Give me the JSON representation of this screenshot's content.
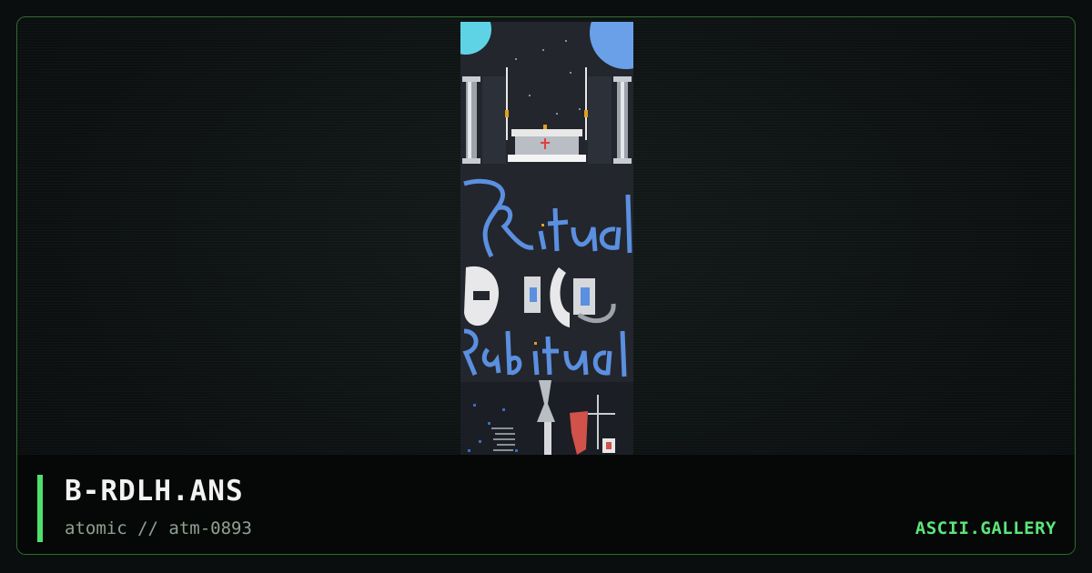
{
  "artwork": {
    "filename": "B-RDLH.ANS",
    "author_line": "atomic // atm-0893",
    "embedded_text": [
      "Ritual",
      "Rabitual"
    ]
  },
  "site": {
    "brand": "ASCII.GALLERY"
  },
  "colors": {
    "accent": "#4fe06d",
    "frame_border": "#2f6a32",
    "art_background": "#23262d",
    "art_blue": "#5b8fe0"
  }
}
